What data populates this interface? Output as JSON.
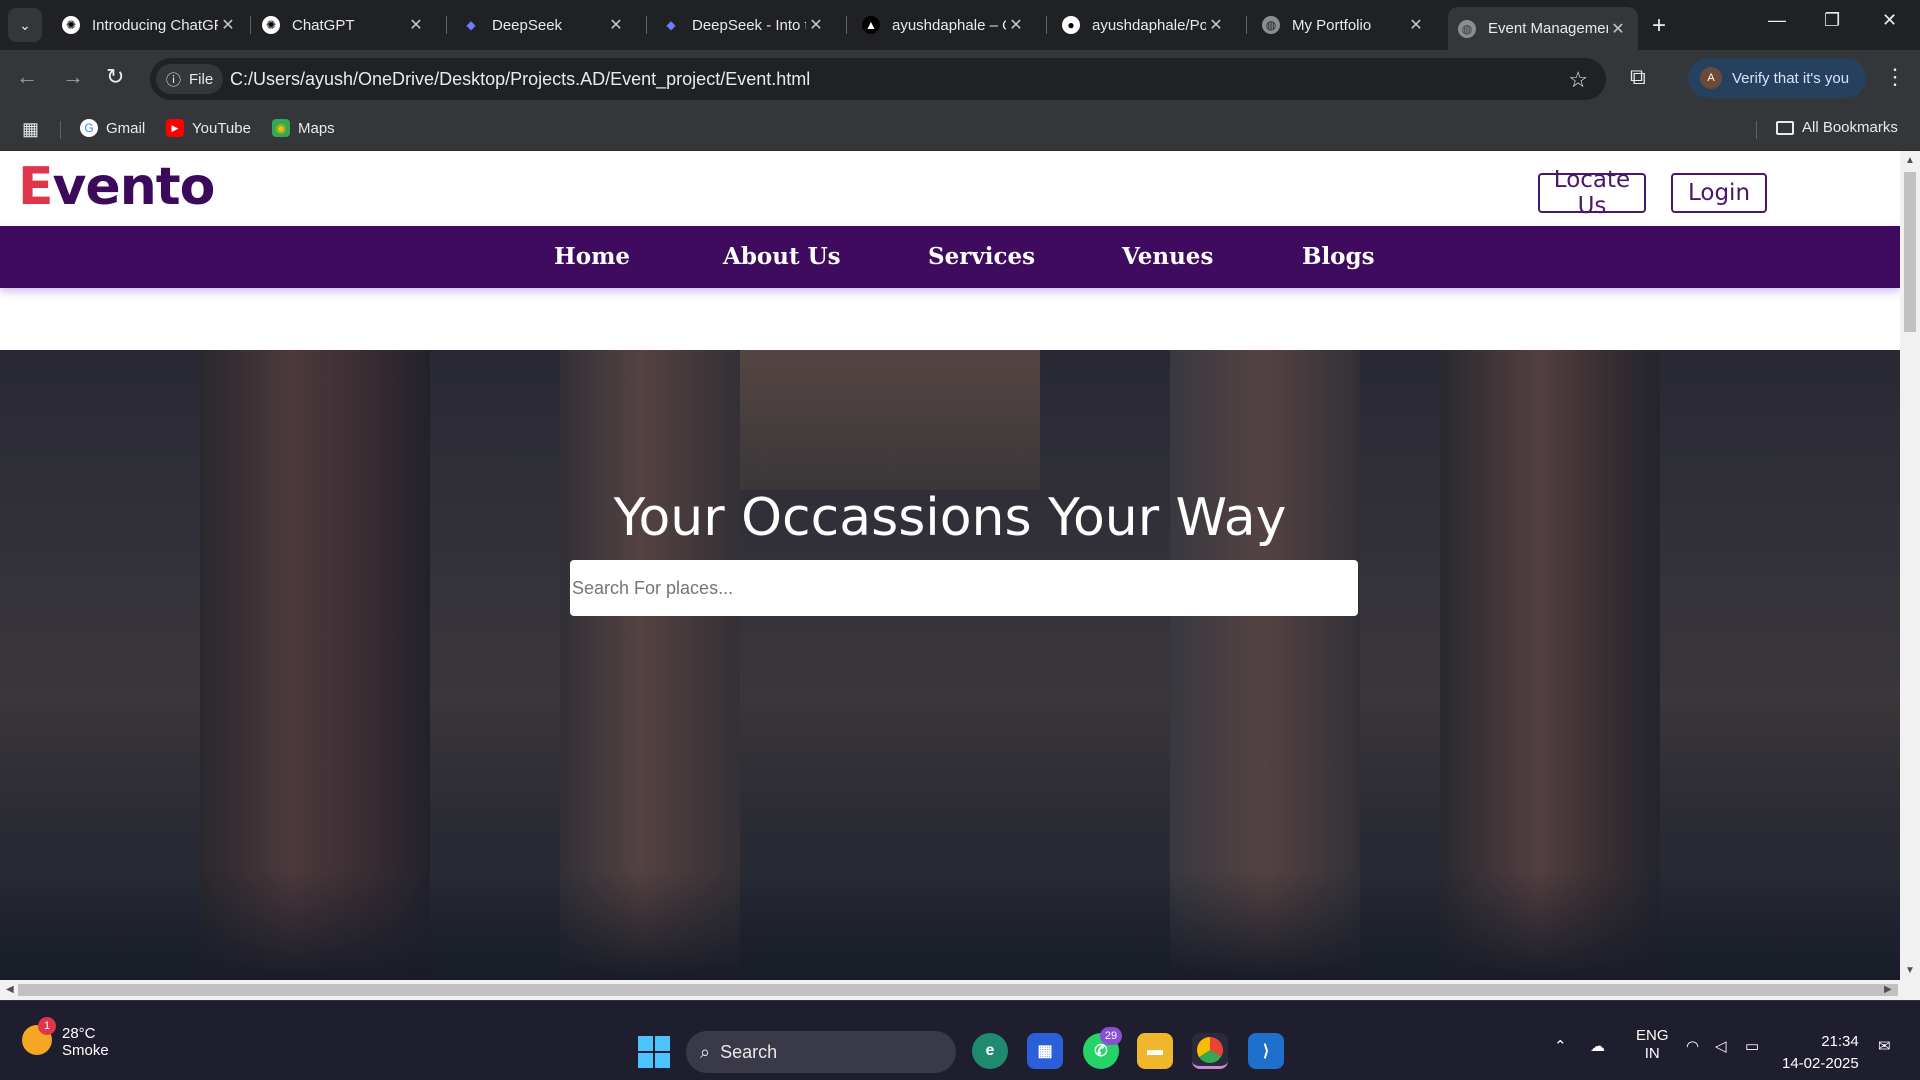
{
  "browser": {
    "tabs": [
      {
        "label": "Introducing ChatGPT",
        "icon": "openai-icon"
      },
      {
        "label": "ChatGPT",
        "icon": "openai-icon"
      },
      {
        "label": "DeepSeek",
        "icon": "deepseek-icon"
      },
      {
        "label": "DeepSeek - Into the Unknown",
        "icon": "deepseek-icon"
      },
      {
        "label": "ayushdaphale – Overview",
        "icon": "vercel-icon"
      },
      {
        "label": "ayushdaphale/Portfolio",
        "icon": "github-icon"
      },
      {
        "label": "My Portfolio",
        "icon": "globe-icon"
      },
      {
        "label": "Event Management",
        "icon": "globe-icon",
        "active": true
      }
    ],
    "address": {
      "chip": "File",
      "url": "C:/Users/ayush/OneDrive/Desktop/Projects.AD/Event_project/Event.html"
    },
    "profile_button": "Verify that it's you",
    "profile_initial": "A",
    "bookmarks": [
      {
        "label": "Gmail",
        "icon": "google-icon"
      },
      {
        "label": "YouTube",
        "icon": "youtube-icon"
      },
      {
        "label": "Maps",
        "icon": "maps-icon"
      }
    ],
    "all_bookmarks": "All Bookmarks"
  },
  "site": {
    "logo_first": "E",
    "logo_rest": "vento",
    "locate_button": "Locate Us",
    "login_button": "Login",
    "nav": [
      "Home",
      "About Us",
      "Services",
      "Venues",
      "Blogs"
    ],
    "hero_title": "Your Occassions Your Way",
    "search_placeholder": "Search For places...",
    "colors": {
      "brand_purple": "#3e0b5e",
      "logo_accent": "#e0354b"
    }
  },
  "taskbar": {
    "weather_temp": "28°C",
    "weather_desc": "Smoke",
    "weather_badge": "1",
    "search_label": "Search",
    "whatsapp_badge": "29",
    "lang_top": "ENG",
    "lang_bottom": "IN",
    "time": "21:34",
    "date": "14-02-2025"
  }
}
